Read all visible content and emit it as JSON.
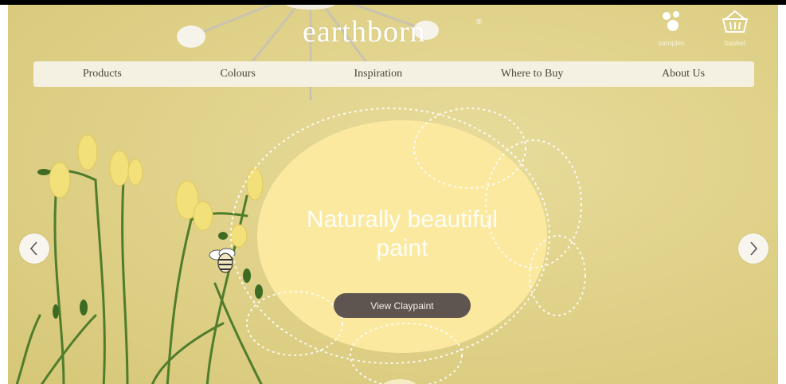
{
  "brand": {
    "logo_text": "earthborn",
    "mark": "®"
  },
  "header_actions": [
    {
      "label": "samples",
      "icon": "samples-icon"
    },
    {
      "label": "basket",
      "icon": "basket-icon"
    }
  ],
  "nav": {
    "items": [
      {
        "label": "Products"
      },
      {
        "label": "Colours"
      },
      {
        "label": "Inspiration"
      },
      {
        "label": "Where to Buy"
      },
      {
        "label": "About Us"
      }
    ]
  },
  "hero": {
    "headline_line1": "Naturally beautiful",
    "headline_line2": "paint",
    "cta_label": "View Claypaint",
    "prev_icon": "chevron-left-icon",
    "next_icon": "chevron-right-icon"
  },
  "colors": {
    "background": "#e0d28a",
    "bubble": "#fbe9a0",
    "cta": "#5e5550",
    "nav_bg": "#f4f1e2",
    "stem_green": "#4f7d2c",
    "flower_yellow": "#f2e07a"
  }
}
